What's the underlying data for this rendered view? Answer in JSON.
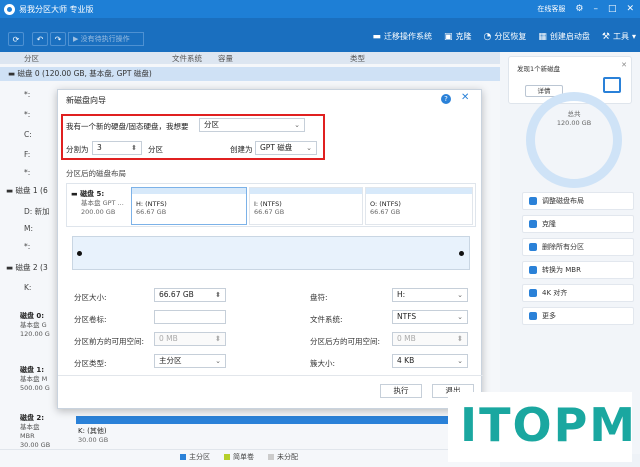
{
  "window": {
    "title": "易我分区大师 专业版",
    "online_service": "在线客服",
    "controls": [
      "⚙",
      "–",
      "□",
      "✕"
    ]
  },
  "toolbar": {
    "refresh_icon": "refresh-icon",
    "undo_icon": "undo-icon",
    "redo_icon": "redo-icon",
    "pending_label": "没有待执行操作",
    "items": [
      {
        "label": "迁移操作系统",
        "icon": "migrate-icon",
        "glyph": "▬"
      },
      {
        "label": "克隆",
        "icon": "clone-icon",
        "glyph": "▣"
      },
      {
        "label": "分区恢复",
        "icon": "recover-icon",
        "glyph": "◔"
      },
      {
        "label": "创建启动盘",
        "icon": "bootdisk-icon",
        "glyph": "▦"
      },
      {
        "label": "工具",
        "icon": "tools-icon",
        "glyph": "⚒"
      }
    ]
  },
  "table": {
    "columns": [
      "分区",
      "文件系统",
      "容量",
      "类型"
    ]
  },
  "tree": {
    "disk0": "磁盘 0 (120.00 GB, 基本盘, GPT 磁盘)",
    "disk0_parts": [
      "*:",
      "*:",
      "C:",
      "F:",
      "*:"
    ],
    "disk1": "磁盘 1 (6",
    "disk1_parts": [
      "D: 新加",
      "M:",
      "*:"
    ],
    "disk2": "磁盘 2 (3",
    "disk2_parts": [
      "K:"
    ],
    "cards": [
      {
        "name": "磁盘 0:",
        "l1": "基本盘 G",
        "l2": "120.00 G"
      },
      {
        "name": "磁盘 1:",
        "l1": "基本盘 M",
        "l2": "500.00 G"
      },
      {
        "name": "磁盘 2:",
        "l1": "基本盘 MBR",
        "l2": "30.00 GB"
      }
    ]
  },
  "right": {
    "new_disk": "发现1个新磁盘",
    "detail_button": "详情",
    "total_label": "总共",
    "total_value": "120.00 GB",
    "ops": [
      {
        "label": "调整磁盘布局",
        "icon": "layout-icon"
      },
      {
        "label": "克隆",
        "icon": "clone-icon"
      },
      {
        "label": "删除所有分区",
        "icon": "delete-icon"
      },
      {
        "label": "转换为 MBR",
        "icon": "convert-icon"
      },
      {
        "label": "4K 对齐",
        "icon": "align-icon"
      },
      {
        "label": "更多",
        "icon": "more-icon"
      }
    ]
  },
  "dialog": {
    "title": "新磁盘向导",
    "question": "我有一个新的硬盘/固态硬盘，我想要",
    "action_value": "分区",
    "split_label": "分割为",
    "split_value": "3",
    "split_unit": "分区",
    "create_label": "创建为",
    "create_value": "GPT 磁盘",
    "layout_title": "分区后的磁盘布局",
    "disk_name": "磁盘 5:",
    "disk_type": "基本盘 GPT ...",
    "disk_size": "200.00 GB",
    "partitions": [
      {
        "label": "H: (NTFS)",
        "size": "66.67 GB"
      },
      {
        "label": "I: (NTFS)",
        "size": "66.67 GB"
      },
      {
        "label": "O: (NTFS)",
        "size": "66.67 GB"
      }
    ],
    "fields": {
      "size_label": "分区大小:",
      "size_value": "66.67 GB",
      "letter_label": "盘符:",
      "letter_value": "H:",
      "volume_label": "分区卷标:",
      "volume_value": "",
      "fs_label": "文件系统:",
      "fs_value": "NTFS",
      "before_label": "分区前方的可用空间:",
      "before_value": "0 MB",
      "after_label": "分区后方的可用空间:",
      "after_value": "0 MB",
      "type_label": "分区类型:",
      "type_value": "主分区",
      "cluster_label": "簇大小:",
      "cluster_value": "4 KB"
    },
    "execute": "执行",
    "exit": "退出"
  },
  "bottom": {
    "part_label": "K: (其他)",
    "part_size": "30.00 GB"
  },
  "legend": [
    {
      "label": "主分区",
      "color": "#2a81d8"
    },
    {
      "label": "简单卷",
      "color": "#b5cf2a"
    },
    {
      "label": "未分配",
      "color": "#cccccc"
    }
  ],
  "watermark": "ITOPM"
}
